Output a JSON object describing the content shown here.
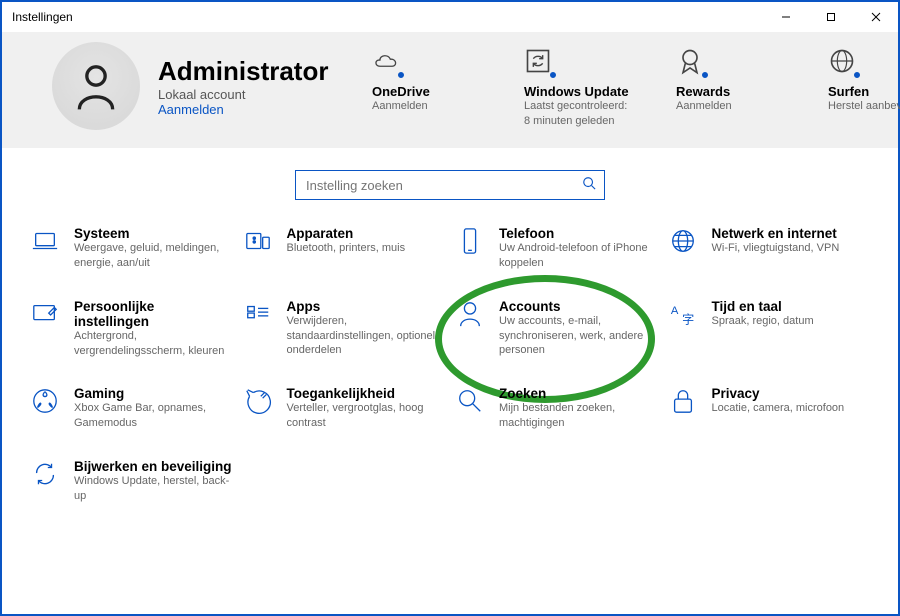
{
  "window": {
    "title": "Instellingen"
  },
  "user": {
    "name": "Administrator",
    "account_type": "Lokaal account",
    "signin_link": "Aanmelden"
  },
  "header_tiles": [
    {
      "id": "onedrive",
      "title": "OneDrive",
      "sub": "Aanmelden"
    },
    {
      "id": "windows-update",
      "title": "Windows Update",
      "sub": "Laatst gecontroleerd: 8 minuten geleden"
    },
    {
      "id": "rewards",
      "title": "Rewards",
      "sub": "Aanmelden"
    },
    {
      "id": "surfen",
      "title": "Surfen",
      "sub": "Herstel aanbevolen"
    }
  ],
  "search": {
    "placeholder": "Instelling zoeken"
  },
  "categories": [
    {
      "id": "systeem",
      "title": "Systeem",
      "sub": "Weergave, geluid, meldingen, energie, aan/uit"
    },
    {
      "id": "apparaten",
      "title": "Apparaten",
      "sub": "Bluetooth, printers, muis"
    },
    {
      "id": "telefoon",
      "title": "Telefoon",
      "sub": "Uw Android-telefoon of iPhone koppelen"
    },
    {
      "id": "netwerk",
      "title": "Netwerk en internet",
      "sub": "Wi-Fi, vliegtuigstand, VPN"
    },
    {
      "id": "persoonlijke",
      "title": "Persoonlijke instellingen",
      "sub": "Achtergrond, vergrendelingsscherm, kleuren"
    },
    {
      "id": "apps",
      "title": "Apps",
      "sub": "Verwijderen, standaardinstellingen, optionele onderdelen"
    },
    {
      "id": "accounts",
      "title": "Accounts",
      "sub": "Uw accounts, e-mail, synchroniseren, werk, andere personen"
    },
    {
      "id": "tijd",
      "title": "Tijd en taal",
      "sub": "Spraak, regio, datum"
    },
    {
      "id": "gaming",
      "title": "Gaming",
      "sub": "Xbox Game Bar, opnames, Gamemodus"
    },
    {
      "id": "toegankelijkheid",
      "title": "Toegankelijkheid",
      "sub": "Verteller, vergrootglas, hoog contrast"
    },
    {
      "id": "zoeken",
      "title": "Zoeken",
      "sub": "Mijn bestanden zoeken, machtigingen"
    },
    {
      "id": "privacy",
      "title": "Privacy",
      "sub": "Locatie, camera, microfoon"
    },
    {
      "id": "bijwerken",
      "title": "Bijwerken en beveiliging",
      "sub": "Windows Update, herstel, back-up"
    }
  ]
}
